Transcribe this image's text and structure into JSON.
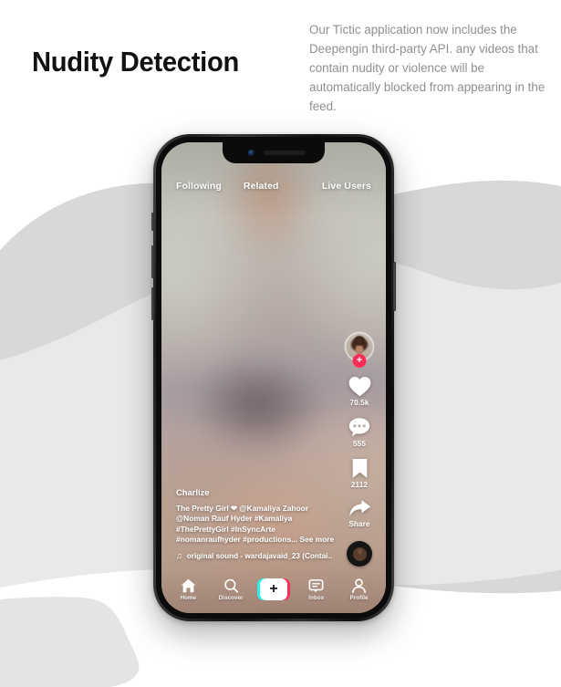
{
  "page": {
    "title": "Nudity Detection",
    "description": "Our Tictic application now includes the Deepengin third-party API.  any videos that contain nudity or violence will be automatically blocked from appearing in the feed."
  },
  "colors": {
    "title": "#111111",
    "description": "#8f8f8f",
    "background": "#ffffff",
    "blob_dark": "#d7d7d7",
    "blob_light": "#e8e8e8",
    "brand_pink": "#fe2c55",
    "brand_cyan": "#25f4ee"
  },
  "phone": {
    "top_tabs": [
      {
        "label": "Following",
        "name": "tab-following",
        "active": false
      },
      {
        "label": "Related",
        "name": "tab-related",
        "active": false
      },
      {
        "label": "Live Users",
        "name": "tab-live-users",
        "active": false
      }
    ],
    "video": {
      "state": "blurred",
      "note": "video content blurred by nudity detection"
    },
    "action_rail": {
      "avatar": {
        "icon": "user-avatar",
        "follow_badge": "+"
      },
      "like": {
        "icon": "heart-icon",
        "count": "70.5k"
      },
      "comment": {
        "icon": "comment-icon",
        "count": "555"
      },
      "bookmark": {
        "icon": "bookmark-icon",
        "count": "2112"
      },
      "share": {
        "icon": "share-arrow-icon",
        "label": "Share"
      },
      "sound_disc": {
        "icon": "spinning-record-icon"
      }
    },
    "caption": {
      "username": "Charlize",
      "lines": [
        "The Pretty Girl ❤ @Kamaliya Zahoor",
        "@Noman Rauf Hyder #Kamaliya",
        "#ThePrettyGirl #InSyncArte",
        "#nomanraufhyder #productions..."
      ],
      "see_more": "See more",
      "sound_note_icon": "♫",
      "sound": "original sound - wardajavaid_23 (Contai.."
    },
    "tabbar": [
      {
        "label": "Home",
        "icon": "home-icon",
        "name": "tabbar-home"
      },
      {
        "label": "Discover",
        "icon": "search-icon",
        "name": "tabbar-discover"
      },
      {
        "label": "",
        "icon": "plus-create-icon",
        "name": "tabbar-create",
        "plus": "+"
      },
      {
        "label": "Inbox",
        "icon": "inbox-message-icon",
        "name": "tabbar-inbox"
      },
      {
        "label": "Profile",
        "icon": "person-icon",
        "name": "tabbar-profile"
      }
    ]
  }
}
